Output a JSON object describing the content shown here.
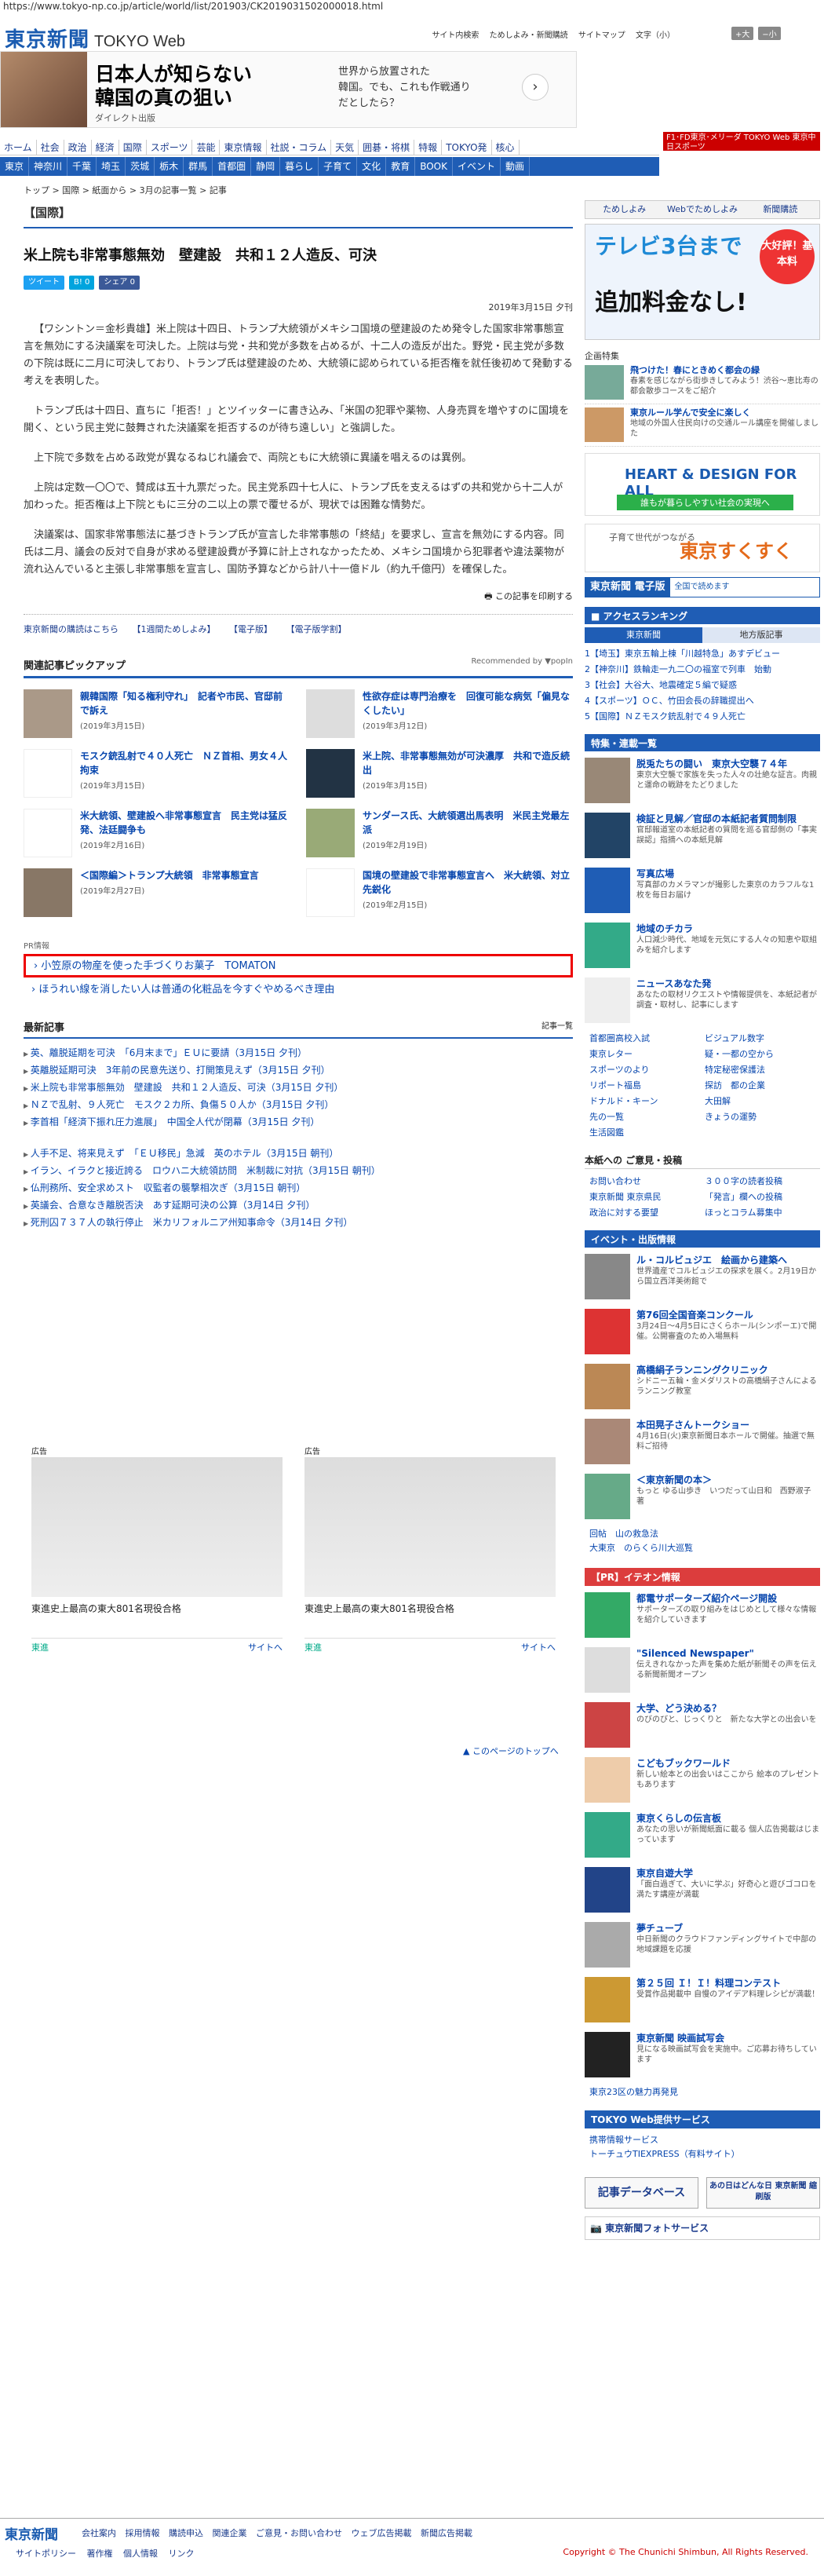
{
  "url": "https://www.tokyo-np.co.jp/article/world/list/201903/CK2019031502000018.html",
  "header": {
    "logo": "東京新聞",
    "logo_web": "TOKYO Web",
    "links": [
      "サイト内検索",
      "ためしよみ・新聞購読",
      "サイトマップ",
      "文字（小）"
    ],
    "size_up": "+大",
    "size_down": "−小"
  },
  "top_ad": {
    "headline_line1": "日本人が知らない",
    "headline_line2": "韓国の真の狙い",
    "sponsor": "ダイレクト出版",
    "text_line1": "世界から放置された",
    "text_line2": "韓国。でも、これも作戦通り",
    "text_line3": "だとしたら？",
    "arrow": "›"
  },
  "right_banner": "F1･FD東京･メリーダ TOKYO Web 東京中日スポーツ",
  "nav1": [
    "ホーム",
    "社会",
    "政治",
    "経済",
    "国際",
    "スポーツ",
    "芸能",
    "東京情報",
    "社説・コラム",
    "天気",
    "囲碁・将棋",
    "特報",
    "TOKYO発",
    "核心"
  ],
  "nav2": [
    "東京",
    "神奈川",
    "千葉",
    "埼玉",
    "茨城",
    "栃木",
    "群馬",
    "首都圏",
    "静岡",
    "暮らし",
    "子育て",
    "文化",
    "教育",
    "BOOK",
    "イベント",
    "動画"
  ],
  "breadcrumb": "トップ > 国際 > 紙面から > 3月の記事一覧 > 記事",
  "article": {
    "section": "【国際】",
    "title": "米上院も非常事態無効　壁建設　共和１２人造反、可決",
    "share": [
      "ツイート",
      "B! 0",
      "シェア 0"
    ],
    "date": "2019年3月15日 夕刊",
    "paragraphs": [
      "【ワシントン＝金杉貴雄】米上院は十四日、トランプ大統領がメキシコ国境の壁建設のため発令した国家非常事態宣言を無効にする決議案を可決した。上院は与党・共和党が多数を占めるが、十二人の造反が出た。野党・民主党が多数の下院は既に二月に可決しており、トランプ氏は壁建設のため、大統領に認められている拒否権を就任後初めて発動する考えを表明した。",
      "トランプ氏は十四日、直ちに「拒否！」とツイッターに書き込み、「米国の犯罪や薬物、人身売買を増やすのに国境を開く、という民主党に鼓舞された決議案を拒否するのが待ち遠しい」と強調した。",
      "上下院で多数を占める政党が異なるねじれ議会で、両院ともに大統領に異議を唱えるのは異例。",
      "上院は定数一〇〇で、賛成は五十九票だった。民主党系四十七人に、トランプ氏を支えるはずの共和党から十二人が加わった。拒否権は上下院ともに三分の二以上の票で覆せるが、現状では困難な情勢だ。",
      "決議案は、国家非常事態法に基づきトランプ氏が宣言した非常事態の「終結」を要求し、宣言を無効にする内容。同氏は二月、議会の反対で自身が求める壁建設費が予算に計上されなかったため、メキシコ国境から犯罪者や違法薬物が流れ込んでいると主張し非常事態を宣言し、国防予算などから計八十一億ドル（約九千億円）を確保した。"
    ],
    "print": "この記事を印刷する",
    "bottom_links": [
      "東京新聞の購読はこちら",
      "【1週間ためしよみ】",
      "【電子版】",
      "【電子版学割】"
    ]
  },
  "pickup": {
    "heading": "関連記事ピックアップ",
    "recommended": "Recommended by ▼popIn",
    "items": [
      {
        "title": "親韓国際「知る権利守れ」　記者や市民、官邸前で訴え",
        "date": "(2019年3月15日)"
      },
      {
        "title": "性欲存症は専門治療を　回復可能な病気「偏見なくしたい」",
        "date": "(2019年3月12日)"
      },
      {
        "title": "モスク銃乱射で４０人死亡　ＮＺ首相、男女４人拘束",
        "date": "(2019年3月15日)"
      },
      {
        "title": "米上院、非常事態無効が可決濃厚　共和で造反続出",
        "date": "(2019年3月15日)"
      },
      {
        "title": "米大統領、壁建設へ非常事態宣言　民主党は猛反発、法廷闘争も",
        "date": "(2019年2月16日)"
      },
      {
        "title": "サンダース氏、大統領選出馬表明　米民主党最左派",
        "date": "(2019年2月19日)"
      },
      {
        "title": "＜国際編＞トランプ大統領　非常事態宣言",
        "date": "(2019年2月27日)"
      },
      {
        "title": "国境の壁建設で非常事態宣言へ　米大統領、対立先鋭化",
        "date": "(2019年2月15日)"
      }
    ]
  },
  "pr": {
    "label": "PR情報",
    "boxed": "小笠原の物産を使った手づくりお菓子　TOMATON",
    "line": "ほうれい線を消したい人は普通の化粧品を今すぐやめるべき理由"
  },
  "latest": {
    "heading": "最新記事",
    "more": "記事一覧",
    "items": [
      "英、離脱延期を可決　「6月末まで」ＥＵに要請（3月15日 夕刊）",
      "英離脱延期可決　3年前の民意先送り、打開策見えず（3月15日 夕刊）",
      "米上院も非常事態無効　壁建設　共和１２人造反、可決（3月15日 夕刊）",
      "ＮＺで乱射、９人死亡　モスク２カ所、負傷５０人か（3月15日 夕刊）",
      "李首相「経済下振れ圧力進展」　中国全人代が閉幕（3月15日 夕刊）",
      "人手不足、将来見えず　「ＥＵ移民」急減　英のホテル（3月15日 朝刊）",
      "イラン、イラクと接近誇る　ロウハニ大統領訪問　米制裁に対抗（3月15日 朝刊）",
      "仏刑務所、安全求めスト　収監者の襲撃相次ぎ（3月15日 朝刊）",
      "英議会、合意なき離脱否決　あす延期可決の公算（3月14日 夕刊）",
      "死刑囚７３７人の執行停止　米カリフォルニア州知事命令（3月14日 夕刊）"
    ]
  },
  "ads_bottom": [
    {
      "label": "広告",
      "caption": "東進史上最高の東大801名現役合格",
      "sponsor": "東進",
      "link": "サイトへ"
    },
    {
      "label": "広告",
      "caption": "東進史上最高の東大801名現役合格",
      "sponsor": "東進",
      "link": "サイトへ"
    }
  ],
  "to_top": "このページのトップへ",
  "sidebar": {
    "buttons": [
      "ためしよみ",
      "Webでためしよみ",
      "新聞購読"
    ],
    "tv_ad": {
      "line1": "テレビ3台まで",
      "line2": "追加料金なし!",
      "badge": "大好評！基本料"
    },
    "featured_label": "企画特集",
    "featured": [
      {
        "title": "飛つけた！春にときめく都会の緑",
        "desc": "春素を感じながら街歩きしてみよう！渋谷〜恵比寿の都会散歩コースをご紹介"
      },
      {
        "title": "東京ルール学んで安全に楽しく",
        "desc": "地域の外国人住民向けの交通ルール講座を開催しました"
      }
    ],
    "promo_heart": "HEART & DESIGN FOR ALL",
    "promo_heart_sub": "誰もが暮らしやすい社会の実現へ",
    "promo_child_sub": "子育て世代がつながる",
    "promo_child": "東京すくすく",
    "promo_denshi_a": "東京新聞 電子版",
    "promo_denshi_b": "全国で読めます",
    "access_head": "アクセスランキング",
    "tabs": [
      "東京新聞",
      "地方版記事"
    ],
    "ranking": [
      "1【埼玉】東京五輪上棟「川越特急」あすデビュー",
      "2【神奈川】鉄輪走一九二〇の福室で列車　始動",
      "3【社会】大谷大、地震確定５編で疑惑",
      "4【スポーツ】ＯＣ、竹田会長の辞職提出へ",
      "5【国際】ＮＺモスク銃乱射で４９人死亡"
    ],
    "feature_head": "特集・連載一覧",
    "features": [
      {
        "title": "脱兎たちの闘い　東京大空襲７４年",
        "desc": "東京大空襲で家族を失った人々の壮絶な証言。肉親と運命の戦跡をたどりました"
      },
      {
        "title": "検証と見解／官邸の本紙記者質問制限",
        "desc": "官邸報道室の本紙記者の質問を巡る官邸側の「事実誤認」指摘への本紙見解"
      },
      {
        "title": "写真広場",
        "desc": "写真部のカメラマンが撮影した東京のカラフルな1枚を毎日お届け"
      },
      {
        "title": "地域のチカラ",
        "desc": "人口減少時代、地域を元気にする人々の知恵や取組みを紹介します"
      },
      {
        "title": "ニュースあなた発",
        "desc": "あなたの取材リクエストや情報提供を、本紙記者が調査・取材し、記事にします"
      }
    ],
    "links_grid": [
      "首都圏高校入試",
      "ビジュアル数字",
      "東京レター",
      "疑・一都の空から",
      "スポーツのより",
      "特定秘密保護法",
      "リポート福島",
      "探訪　都の企業",
      "ドナルド・キーン",
      "大田解",
      "先の一覧",
      "きょうの運勢",
      "生活図鑑",
      ""
    ],
    "opinion_head": "本紙への ご意見・投稿",
    "opinions": [
      "お問い合わせ",
      "３００字の読者投稿",
      "東京新聞 東京県民",
      "「発言」欄への投稿",
      "政治に対する要望",
      "ほっとコラム募集中"
    ],
    "event_head": "イベント・出版情報",
    "events": [
      {
        "title": "ル・コルビュジエ　絵画から建築へ",
        "desc": "世界遺産でコルビュジエの探求を展く。2月19日から国立西洋美術館で"
      },
      {
        "title": "第76回全国音楽コンクール",
        "desc": "3月24日〜4月5日にさくらホール(シンポーエ)で開催。公開審査のため入場無料"
      },
      {
        "title": "高橋絹子ランニングクリニック",
        "desc": "シドニー五輪・金メダリストの高橋絹子さんによるランニング教室"
      },
      {
        "title": "本田晃子さんトークショー",
        "desc": "4月16日(火)東京新聞日本ホールで開催。抽選で無料ご招待"
      },
      {
        "title": "＜東京新聞の本＞",
        "desc": "もっと ゆる山歩き　いつだって山日和　西野淑子 著"
      }
    ],
    "event_links": [
      "回帖　山の救急法",
      "大東京　のらくら川大巡覧"
    ],
    "ieon_head": "【PR】イテオン情報",
    "ieon": [
      {
        "title": "都電サポーターズ紹介ページ開設",
        "desc": "サポーターズの取り組みをはじめとして様々な情報を紹介していきます"
      },
      {
        "title": "\"Silenced Newspaper\"",
        "desc": "伝えきれなかった声を集めた紙が新聞その声を伝える新聞新聞オープン"
      },
      {
        "title": "大学、どう決める？",
        "desc": "のびのびと、じっくりと　新たな大学との出会いを"
      },
      {
        "title": "こどもブックワールド",
        "desc": "新しい絵本との出会いはここから 絵本のプレゼントもあります"
      },
      {
        "title": "東京くらしの伝言板",
        "desc": "あなたの思いが新聞紙面に載る 個人広告掲載はじまっています"
      },
      {
        "title": "東京自遊大学",
        "desc": "「面白過ぎて、大いに学ぶ」好奇心と遊びゴコロを満たす講座が満載"
      },
      {
        "title": "夢チューブ",
        "desc": "中日新聞のクラウドファンディングサイトで中部の地域課題を応援"
      },
      {
        "title": "第２５回 Ｉ！Ｉ！料理コンテスト",
        "desc": "受賞作品掲載中 自慢のアイデア料理レシピが満載！"
      },
      {
        "title": "東京新聞 映画試写会",
        "desc": "見になる映画試写会を実施中。ご応募お待ちしています"
      }
    ],
    "ieon_link": "東京23区の魅力再発見",
    "service_head": "TOKYO Web提供サービス",
    "services": [
      "携帯情報サービス",
      "トーチュウTIEXPRESS（有料サイト）"
    ],
    "db_button": "記事データベース",
    "ako_button": "あの日はどんな日 東京新聞 縮刷版",
    "photo": "東京新聞フォトサービス"
  },
  "footer": {
    "logo": "東京新聞",
    "links": [
      "会社案内",
      "採用情報",
      "購読申込",
      "関連企業",
      "ご意見・お問い合わせ",
      "ウェブ広告掲載",
      "新聞広告掲載"
    ],
    "links2": [
      "サイトポリシー",
      "著作権",
      "個人情報",
      "リンク"
    ],
    "copyright": "Copyright © The Chunichi Shimbun, All Rights Reserved."
  }
}
